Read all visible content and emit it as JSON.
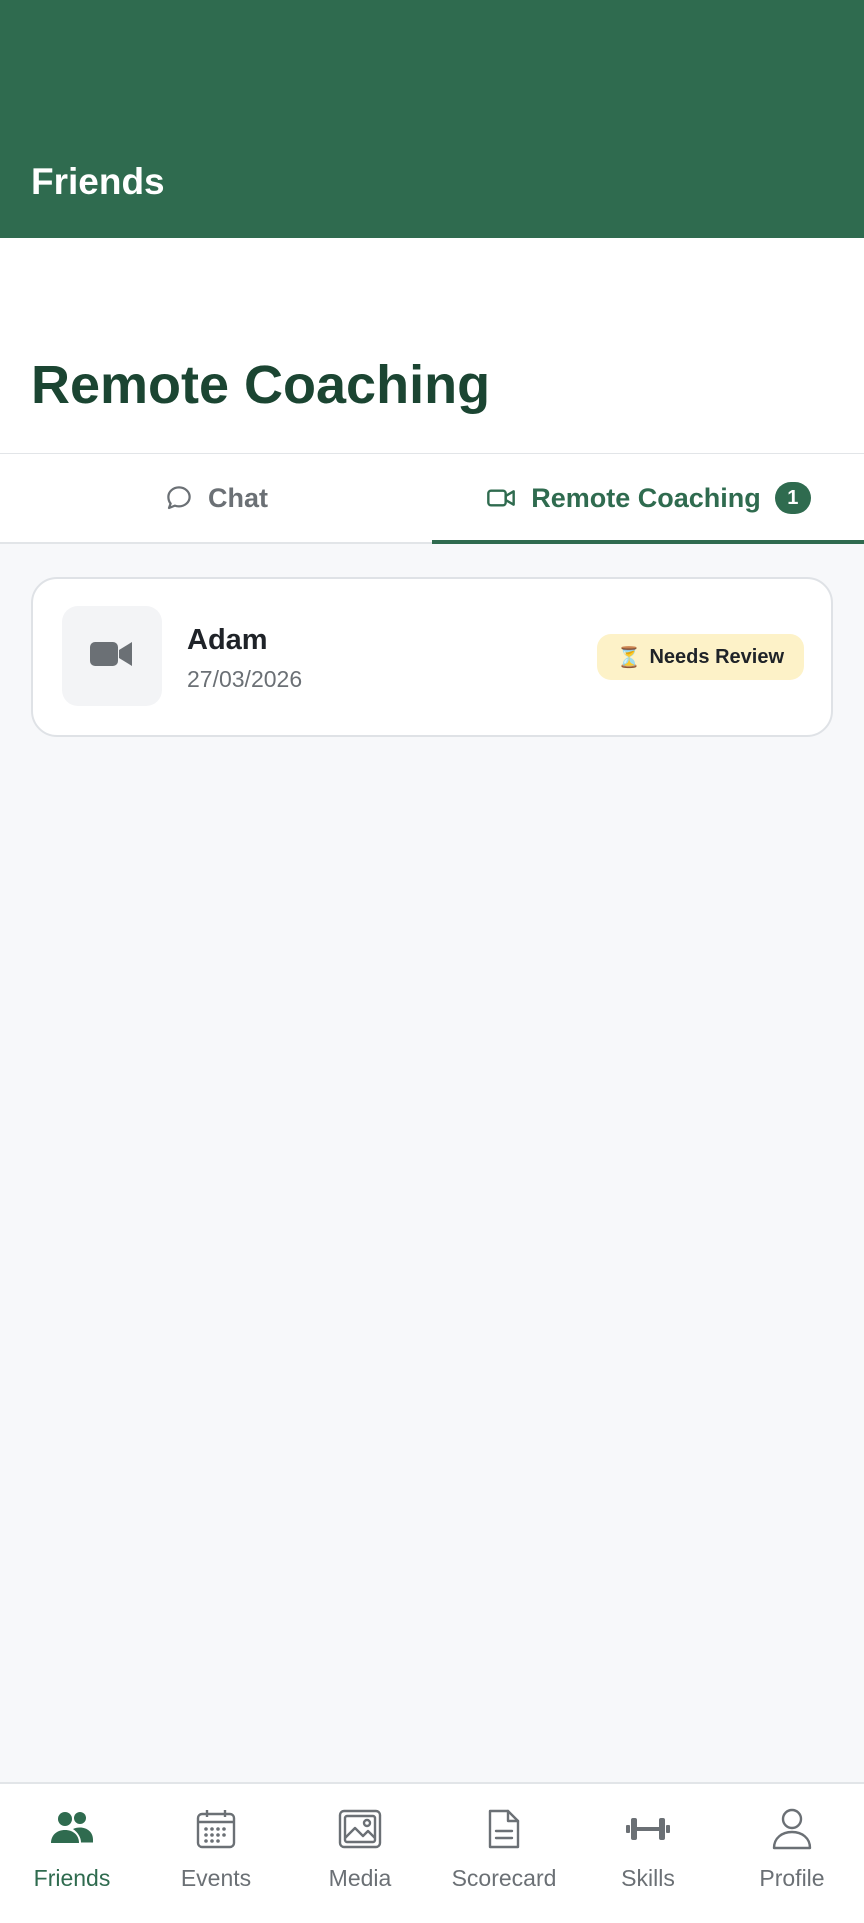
{
  "app_bar": {
    "title": "Friends"
  },
  "page": {
    "title": "Remote Coaching"
  },
  "tabs": [
    {
      "label": "Chat",
      "icon": "chat-bubble-icon",
      "active": false
    },
    {
      "label": "Remote Coaching",
      "icon": "video-camera-icon",
      "active": true,
      "badge": "1"
    }
  ],
  "sessions": [
    {
      "name": "Adam",
      "date": "27/03/2026",
      "status": "Needs Review",
      "status_emoji": "⏳",
      "thumbnail_icon": "video-camera-icon"
    }
  ],
  "bottom_nav": [
    {
      "label": "Friends",
      "icon": "friends-icon",
      "active": true
    },
    {
      "label": "Events",
      "icon": "calendar-icon",
      "active": false
    },
    {
      "label": "Media",
      "icon": "image-gallery-icon",
      "active": false
    },
    {
      "label": "Scorecard",
      "icon": "document-icon",
      "active": false
    },
    {
      "label": "Skills",
      "icon": "dumbbell-icon",
      "active": false
    },
    {
      "label": "Profile",
      "icon": "user-icon",
      "active": false
    }
  ],
  "colors": {
    "primary": "#2f6b4f",
    "title": "#1b4532",
    "badge_bg": "#fdf2c8",
    "muted": "#6b7075",
    "background": "#f7f8fa"
  }
}
